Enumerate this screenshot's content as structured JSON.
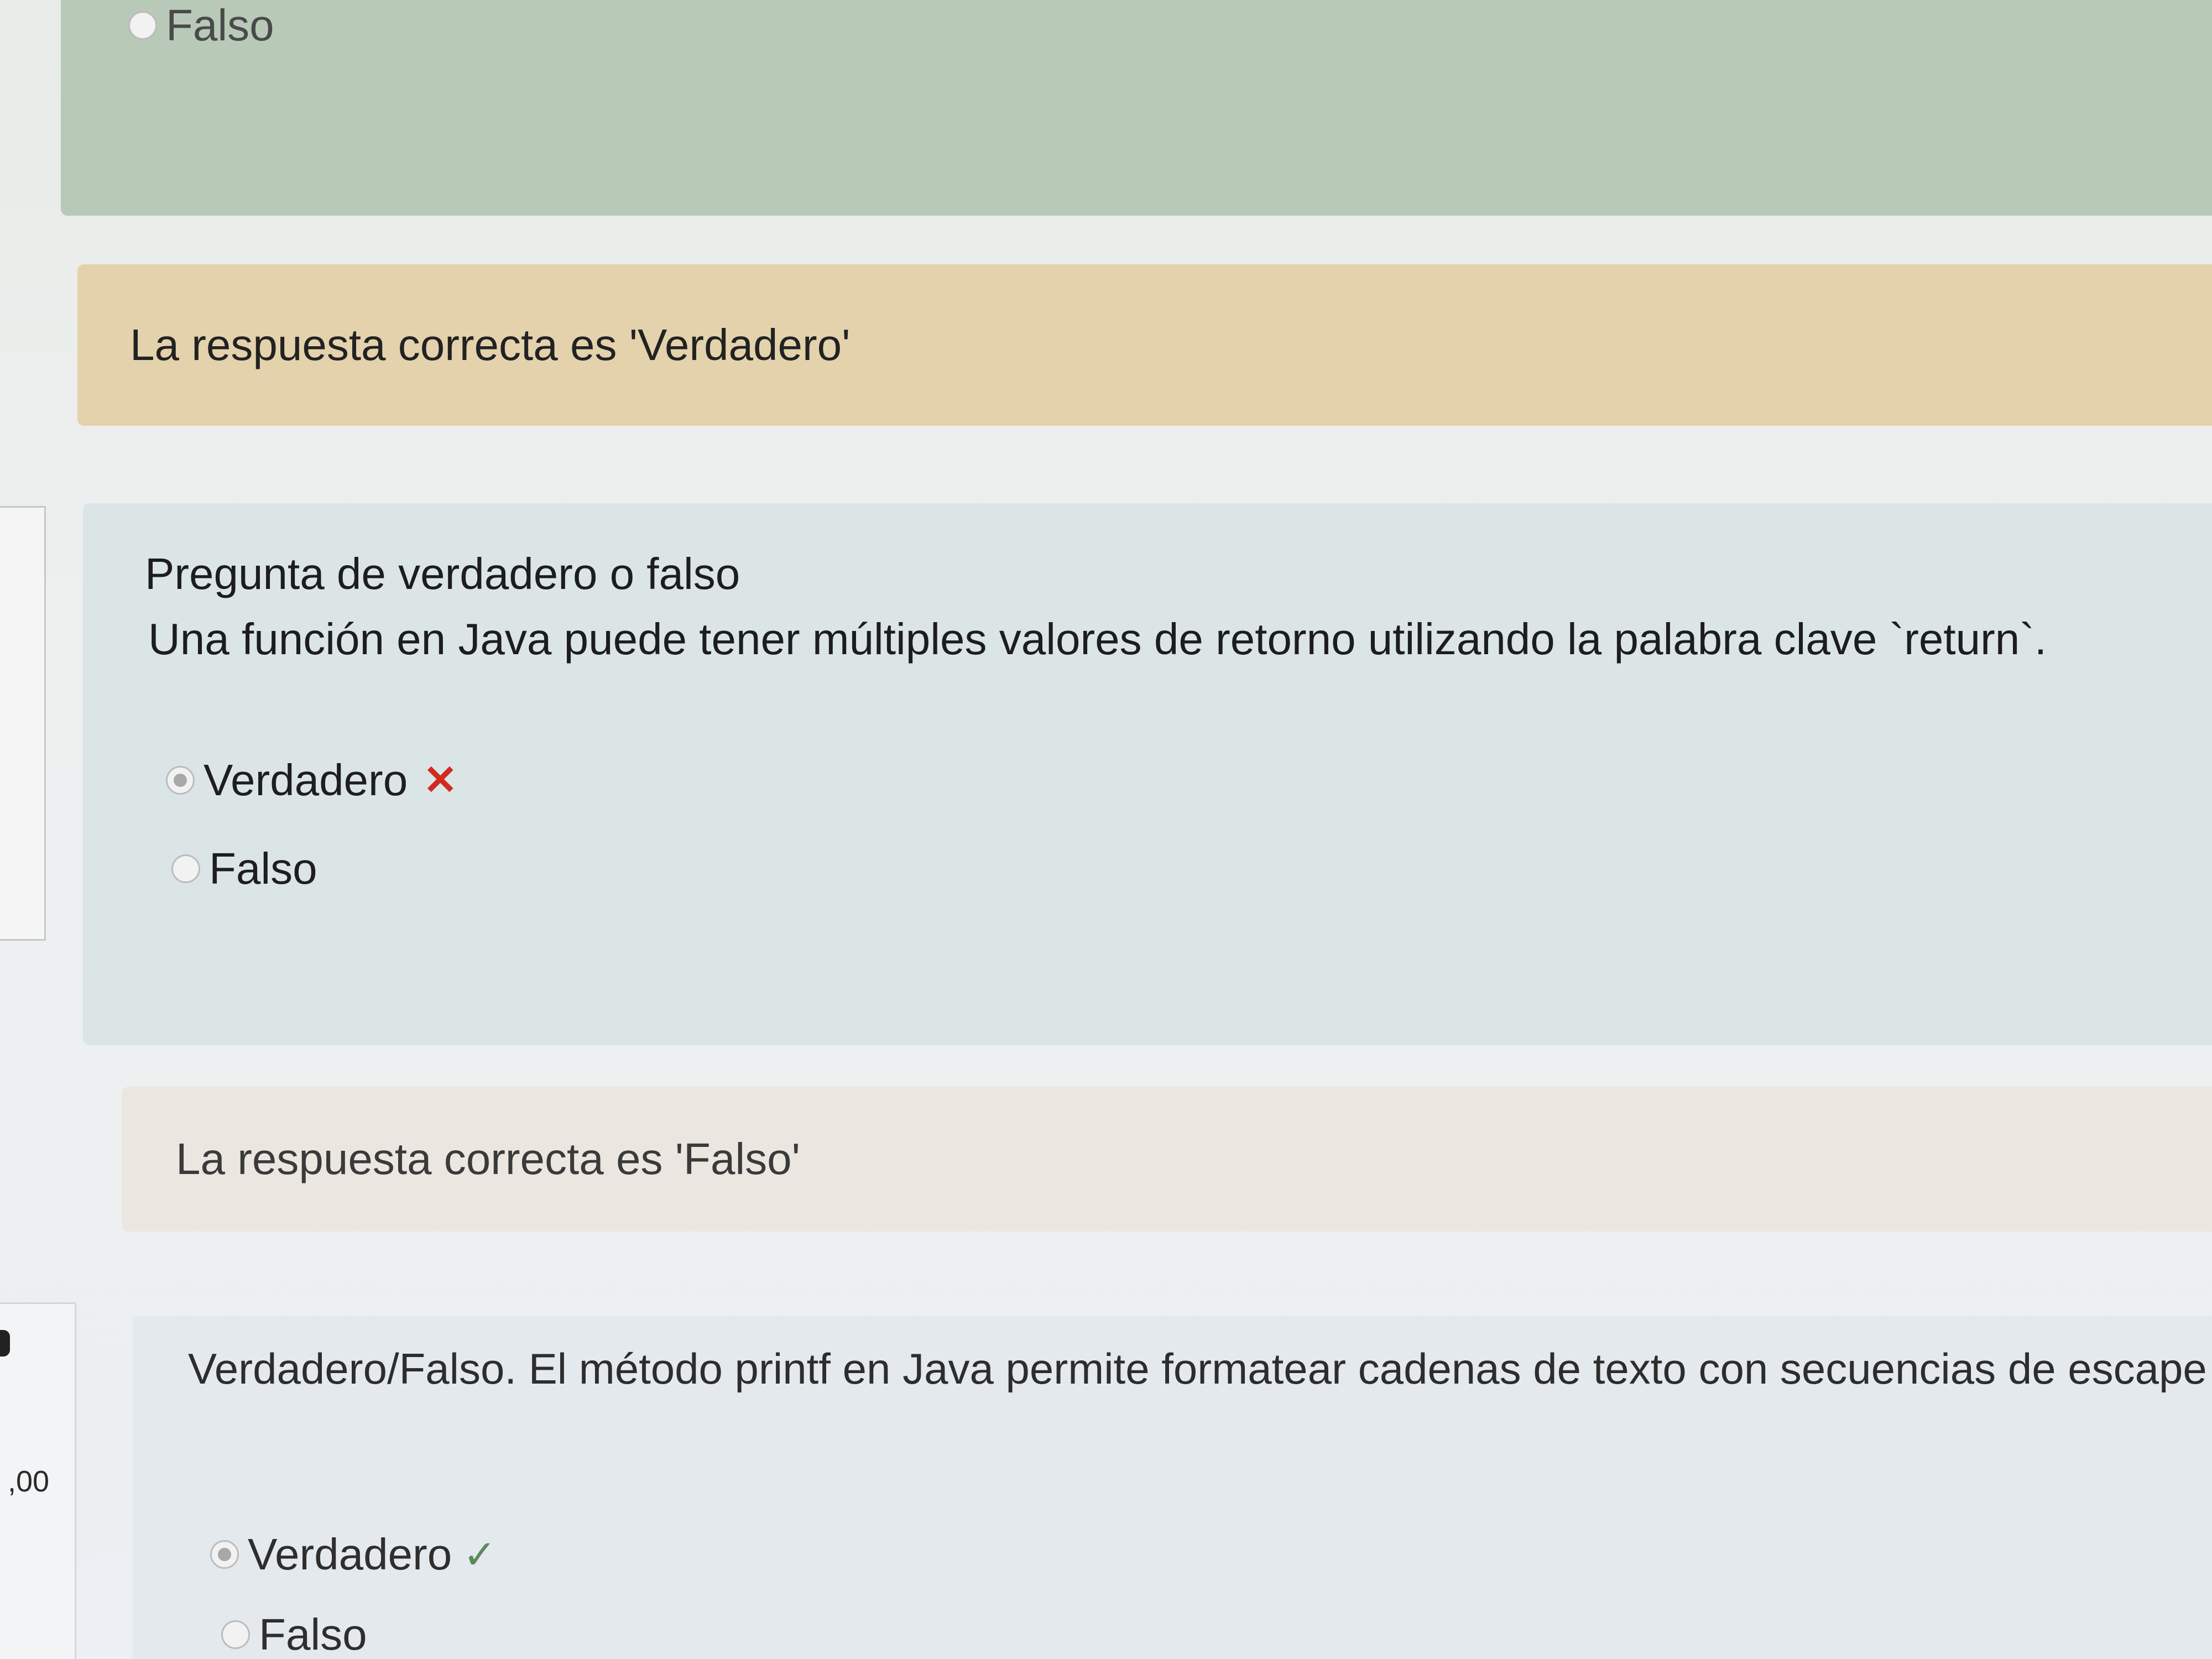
{
  "previous_question": {
    "options": [
      {
        "label": "Falso",
        "selected": false
      }
    ]
  },
  "feedback_1": {
    "text": "La respuesta correcta es 'Verdadero'"
  },
  "question_1": {
    "type_label": "Pregunta de verdadero o falso",
    "text": "Una función en Java puede tener múltiples valores de retorno utilizando la palabra clave `return`.",
    "options": [
      {
        "label": "Verdadero",
        "selected": true,
        "mark": "✕",
        "mark_icon": "incorrect-x-icon",
        "mark_color": "#d12a20"
      },
      {
        "label": "Falso",
        "selected": false
      }
    ]
  },
  "feedback_2": {
    "text": "La respuesta correcta es 'Falso'"
  },
  "question_2": {
    "grade_fragment": ",00",
    "text": "Verdadero/Falso. El método printf en Java permite formatear cadenas de texto con secuencias de escape cor",
    "options": [
      {
        "label": "Verdadero",
        "selected": true,
        "mark": "✓",
        "mark_icon": "correct-check-icon",
        "mark_color": "#5a8a5a"
      },
      {
        "label": "Falso",
        "selected": false
      }
    ]
  },
  "colors": {
    "formulation_green": "#b8c9b8",
    "feedback_yellow": "#e3d2ac",
    "formulation_blue": "#dbe5e6",
    "feedback_beige": "#ebe6e0",
    "incorrect_red": "#d12a20",
    "correct_green": "#5a8a5a"
  }
}
